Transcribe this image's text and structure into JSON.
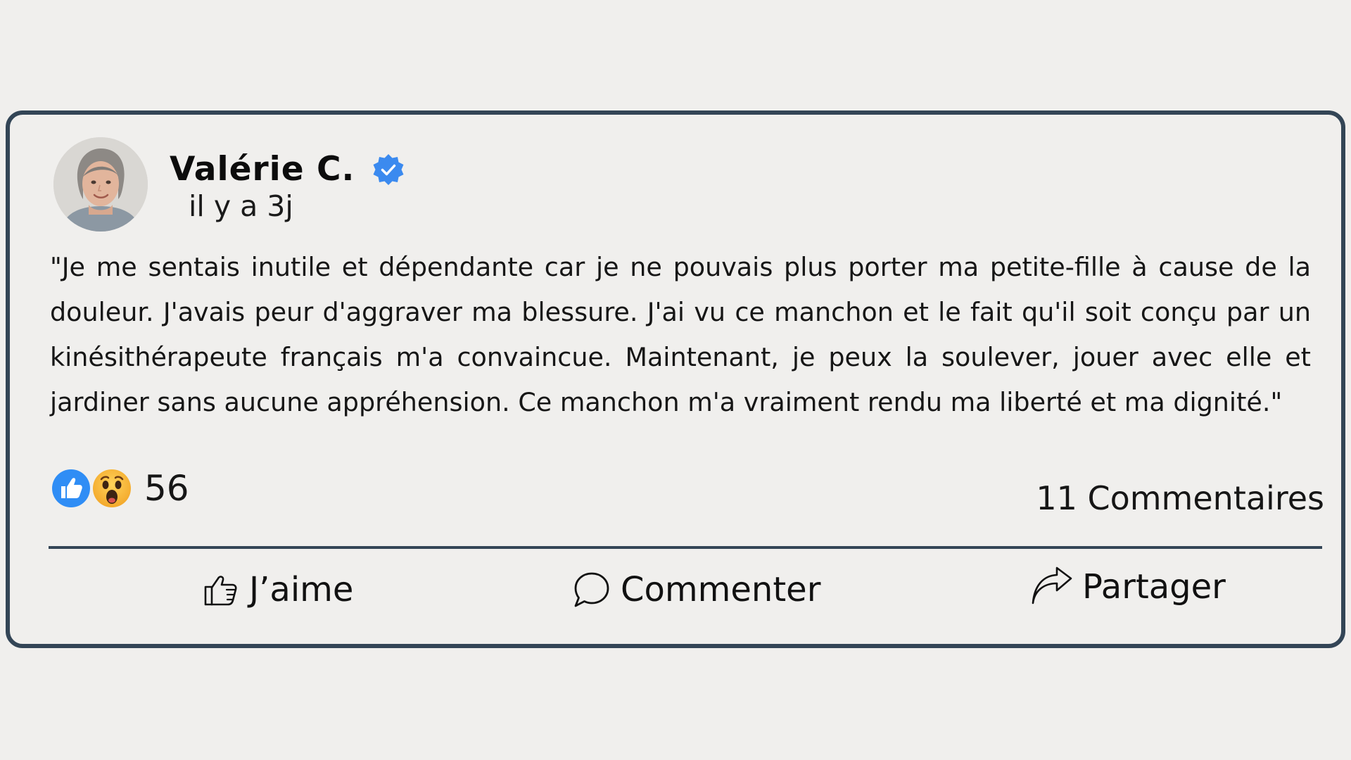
{
  "post": {
    "author": "Valérie C.",
    "timestamp": "il y a 3j",
    "text": "\"Je me sentais inutile et dépendante car je ne pouvais plus porter ma petite-fille à cause de la douleur. J'avais peur d'aggraver ma blessure. J'ai vu ce manchon et le fait qu'il soit conçu par un kinésithérapeute français m'a convaincue. Maintenant, je peux la soulever, jouer avec elle et jardiner sans aucune appréhension. Ce manchon m'a vraiment rendu ma liberté et ma dignité.\"",
    "reactions": {
      "icons": [
        "like-icon",
        "wow-icon"
      ],
      "count": "56"
    },
    "comments_count": "11 Commentaires"
  },
  "actions": {
    "like_label": "J’aime",
    "comment_label": "Commenter",
    "share_label": "Partager"
  },
  "icons": {
    "verified": "verified-badge-icon",
    "like": "thumbs-up-outline-icon",
    "comment": "speech-bubble-icon",
    "share": "share-arrow-icon"
  },
  "colors": {
    "border": "#334556",
    "background": "#f0efed",
    "verified": "#3b8aef",
    "like_reaction": "#2f8df5",
    "wow_reaction": "#f5b730"
  }
}
